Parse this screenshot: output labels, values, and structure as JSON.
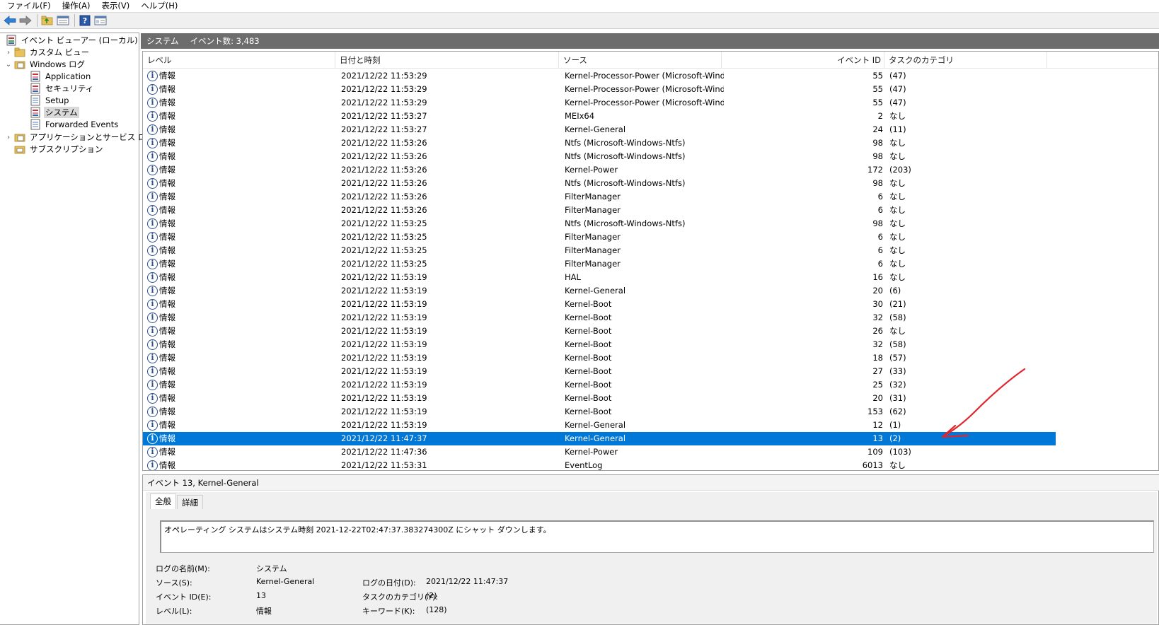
{
  "menu": [
    "ファイル(F)",
    "操作(A)",
    "表示(V)",
    "ヘルプ(H)"
  ],
  "toolbar": {
    "icons": [
      "back-arrow-icon",
      "forward-arrow-icon",
      "folder-up-icon",
      "properties-icon",
      "help-icon",
      "console-tree-icon"
    ]
  },
  "tree": {
    "root": "イベント ビューアー (ローカル)",
    "custom_views": "カスタム ビュー",
    "windows_logs": "Windows ログ",
    "application": "Application",
    "security": "セキュリティ",
    "setup": "Setup",
    "system": "システム",
    "forwarded": "Forwarded Events",
    "app_service_logs": "アプリケーションとサービス ログ",
    "subscriptions": "サブスクリプション"
  },
  "header": {
    "title": "システム",
    "count": "イベント数: 3,483"
  },
  "columns": {
    "level": "レベル",
    "date": "日付と時刻",
    "source": "ソース",
    "event_id": "イベント ID",
    "category": "タスクのカテゴリ"
  },
  "events": [
    {
      "level": "情報",
      "date": "2021/12/22 11:53:29",
      "source": "Kernel-Processor-Power (Microsoft-Wind...",
      "id": "55",
      "category": "(47)"
    },
    {
      "level": "情報",
      "date": "2021/12/22 11:53:29",
      "source": "Kernel-Processor-Power (Microsoft-Wind...",
      "id": "55",
      "category": "(47)"
    },
    {
      "level": "情報",
      "date": "2021/12/22 11:53:29",
      "source": "Kernel-Processor-Power (Microsoft-Wind...",
      "id": "55",
      "category": "(47)"
    },
    {
      "level": "情報",
      "date": "2021/12/22 11:53:27",
      "source": "MEIx64",
      "id": "2",
      "category": "なし"
    },
    {
      "level": "情報",
      "date": "2021/12/22 11:53:27",
      "source": "Kernel-General",
      "id": "24",
      "category": "(11)"
    },
    {
      "level": "情報",
      "date": "2021/12/22 11:53:26",
      "source": "Ntfs (Microsoft-Windows-Ntfs)",
      "id": "98",
      "category": "なし"
    },
    {
      "level": "情報",
      "date": "2021/12/22 11:53:26",
      "source": "Ntfs (Microsoft-Windows-Ntfs)",
      "id": "98",
      "category": "なし"
    },
    {
      "level": "情報",
      "date": "2021/12/22 11:53:26",
      "source": "Kernel-Power",
      "id": "172",
      "category": "(203)"
    },
    {
      "level": "情報",
      "date": "2021/12/22 11:53:26",
      "source": "Ntfs (Microsoft-Windows-Ntfs)",
      "id": "98",
      "category": "なし"
    },
    {
      "level": "情報",
      "date": "2021/12/22 11:53:26",
      "source": "FilterManager",
      "id": "6",
      "category": "なし"
    },
    {
      "level": "情報",
      "date": "2021/12/22 11:53:26",
      "source": "FilterManager",
      "id": "6",
      "category": "なし"
    },
    {
      "level": "情報",
      "date": "2021/12/22 11:53:25",
      "source": "Ntfs (Microsoft-Windows-Ntfs)",
      "id": "98",
      "category": "なし"
    },
    {
      "level": "情報",
      "date": "2021/12/22 11:53:25",
      "source": "FilterManager",
      "id": "6",
      "category": "なし"
    },
    {
      "level": "情報",
      "date": "2021/12/22 11:53:25",
      "source": "FilterManager",
      "id": "6",
      "category": "なし"
    },
    {
      "level": "情報",
      "date": "2021/12/22 11:53:25",
      "source": "FilterManager",
      "id": "6",
      "category": "なし"
    },
    {
      "level": "情報",
      "date": "2021/12/22 11:53:19",
      "source": "HAL",
      "id": "16",
      "category": "なし"
    },
    {
      "level": "情報",
      "date": "2021/12/22 11:53:19",
      "source": "Kernel-General",
      "id": "20",
      "category": "(6)"
    },
    {
      "level": "情報",
      "date": "2021/12/22 11:53:19",
      "source": "Kernel-Boot",
      "id": "30",
      "category": "(21)"
    },
    {
      "level": "情報",
      "date": "2021/12/22 11:53:19",
      "source": "Kernel-Boot",
      "id": "32",
      "category": "(58)"
    },
    {
      "level": "情報",
      "date": "2021/12/22 11:53:19",
      "source": "Kernel-Boot",
      "id": "26",
      "category": "なし"
    },
    {
      "level": "情報",
      "date": "2021/12/22 11:53:19",
      "source": "Kernel-Boot",
      "id": "32",
      "category": "(58)"
    },
    {
      "level": "情報",
      "date": "2021/12/22 11:53:19",
      "source": "Kernel-Boot",
      "id": "18",
      "category": "(57)"
    },
    {
      "level": "情報",
      "date": "2021/12/22 11:53:19",
      "source": "Kernel-Boot",
      "id": "27",
      "category": "(33)"
    },
    {
      "level": "情報",
      "date": "2021/12/22 11:53:19",
      "source": "Kernel-Boot",
      "id": "25",
      "category": "(32)"
    },
    {
      "level": "情報",
      "date": "2021/12/22 11:53:19",
      "source": "Kernel-Boot",
      "id": "20",
      "category": "(31)"
    },
    {
      "level": "情報",
      "date": "2021/12/22 11:53:19",
      "source": "Kernel-Boot",
      "id": "153",
      "category": "(62)"
    },
    {
      "level": "情報",
      "date": "2021/12/22 11:53:19",
      "source": "Kernel-General",
      "id": "12",
      "category": "(1)"
    },
    {
      "level": "情報",
      "date": "2021/12/22 11:47:37",
      "source": "Kernel-General",
      "id": "13",
      "category": "(2)",
      "selected": true
    },
    {
      "level": "情報",
      "date": "2021/12/22 11:47:36",
      "source": "Kernel-Power",
      "id": "109",
      "category": "(103)"
    },
    {
      "level": "情報",
      "date": "2021/12/22 11:53:31",
      "source": "EventLog",
      "id": "6013",
      "category": "なし"
    }
  ],
  "detail": {
    "title": "イベント 13, Kernel-General",
    "tab_general": "全般",
    "tab_details": "詳細",
    "message": "オペレーティング システムはシステム時刻 2021-12-22T02:47:37.383274300Z にシャット ダウンします。",
    "log_name_label": "ログの名前(M):",
    "log_name": "システム",
    "source_label": "ソース(S):",
    "source": "Kernel-General",
    "logged_label": "ログの日付(D):",
    "logged": "2021/12/22 11:47:37",
    "event_id_label": "イベント ID(E):",
    "event_id": "13",
    "task_label": "タスクのカテゴリ(Y):",
    "task": "(2)",
    "level_label": "レベル(L):",
    "level": "情報",
    "keywords_label": "キーワード(K):",
    "keywords": "(128)"
  },
  "colors": {
    "selection": "#0078d7",
    "header_bar": "#6d6d6d",
    "annotation": "#e0262b"
  }
}
